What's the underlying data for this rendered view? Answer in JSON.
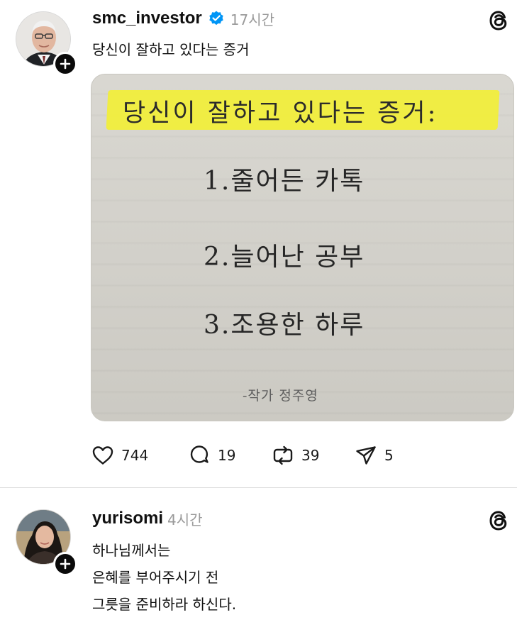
{
  "posts": [
    {
      "username": "smc_investor",
      "verified": true,
      "timestamp": "17시간",
      "caption": "당신이 잘하고 있다는 증거",
      "image": {
        "title": "당신이 잘하고 있다는 증거:",
        "items": [
          "1.줄어든 카톡",
          "2.늘어난 공부",
          "3.조용한 하루"
        ],
        "author": "-작가 정주영",
        "highlight_color": "#f2ef37"
      },
      "actions": {
        "likes": "744",
        "replies": "19",
        "reposts": "39",
        "shares": "5"
      }
    },
    {
      "username": "yurisomi",
      "verified": false,
      "timestamp": "4시간",
      "lines": [
        "하나님께서는",
        "은혜를 부어주시기 전",
        "그릇을 준비하라 하신다."
      ]
    }
  ],
  "icons": {
    "verified": "verified-badge-icon",
    "follow": "plus-icon",
    "brand": "threads-logo-icon",
    "like": "heart-icon",
    "reply": "speech-bubble-icon",
    "repost": "repost-icon",
    "share": "paper-plane-icon"
  },
  "colors": {
    "verified_blue": "#0095f6",
    "text": "#101010",
    "muted": "#9a9a9a",
    "divider": "#dcdcdc"
  }
}
